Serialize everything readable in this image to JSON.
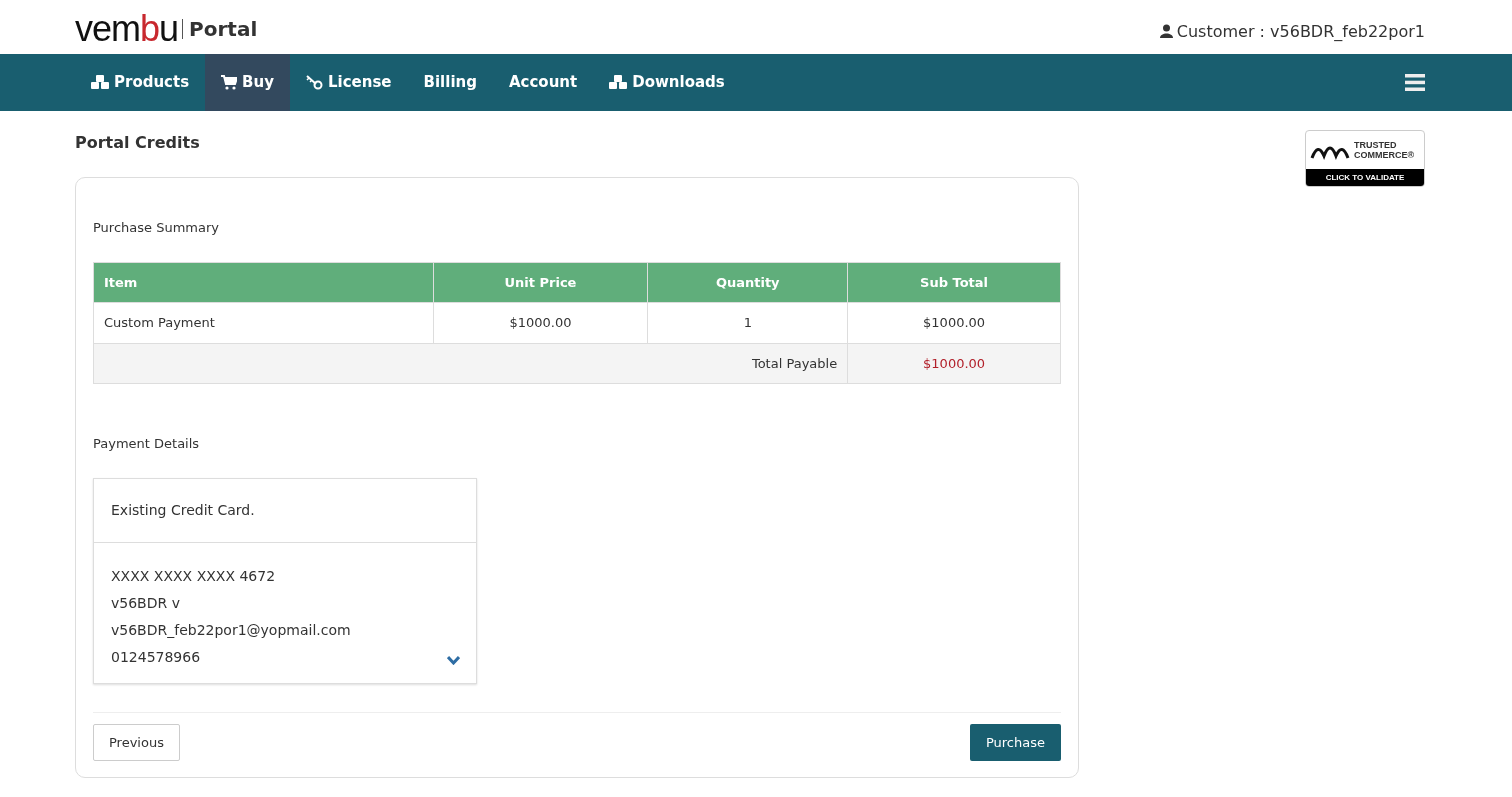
{
  "brand": {
    "logo": "vembu",
    "product": "Portal"
  },
  "customer": "Customer : v56BDR_feb22por1",
  "nav": [
    {
      "label": "Products",
      "kind": "cubes",
      "selected": false
    },
    {
      "label": "Buy",
      "kind": "cart",
      "selected": true
    },
    {
      "label": "License",
      "kind": "key",
      "selected": false
    },
    {
      "label": "Billing",
      "kind": "plain",
      "selected": false
    },
    {
      "label": "Account",
      "kind": "plain",
      "selected": false
    },
    {
      "label": "Downloads",
      "kind": "cubes",
      "selected": false
    }
  ],
  "page_title": "Portal Credits",
  "trust_badge": {
    "line1": "TRUSTED",
    "line2": "COMMERCE®",
    "action": "CLICK TO VALIDATE"
  },
  "summary": {
    "heading": "Purchase Summary",
    "columns": [
      "Item",
      "Unit Price",
      "Quantity",
      "Sub Total"
    ],
    "rows": [
      [
        "Custom Payment",
        "$1000.00",
        "1",
        "$1000.00"
      ]
    ],
    "total_label": "Total Payable",
    "total": "$1000.00"
  },
  "payment": {
    "heading": "Payment Details",
    "card_title": "Existing Credit Card.",
    "lines": [
      "XXXX XXXX XXXX 4672",
      "v56BDR v",
      "v56BDR_feb22por1@yopmail.com",
      "0124578966"
    ],
    "expanded": false
  },
  "buttons": {
    "previous": "Previous",
    "purchase": "Purchase"
  }
}
